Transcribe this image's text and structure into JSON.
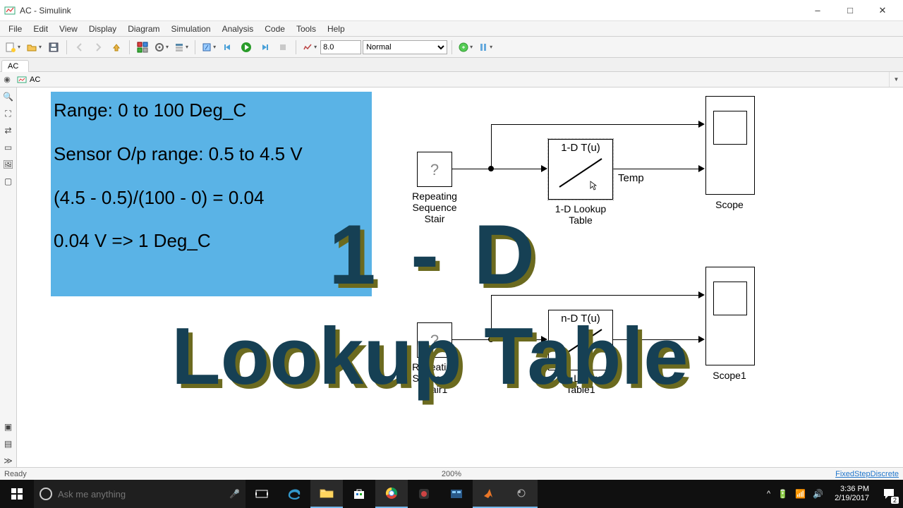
{
  "window": {
    "title": "AC - Simulink"
  },
  "menu": [
    "File",
    "Edit",
    "View",
    "Display",
    "Diagram",
    "Simulation",
    "Analysis",
    "Code",
    "Tools",
    "Help"
  ],
  "toolbar": {
    "stop_time": "8.0",
    "mode": "Normal"
  },
  "tab": {
    "name": "AC"
  },
  "breadcrumb": {
    "model": "AC"
  },
  "annotation": {
    "line1": "Range: 0 to 100 Deg_C",
    "line2": "Sensor O/p range: 0.5 to 4.5 V",
    "line3": "(4.5 - 0.5)/(100 - 0) = 0.04",
    "line4": "0.04 V => 1 Deg_C"
  },
  "blocks": {
    "rss1": {
      "label": "Repeating\nSequence\nStair",
      "glyph": "?"
    },
    "lut1": {
      "header": "1-D T(u)",
      "label": "1-D Lookup\nTable"
    },
    "sig_temp": "Temp",
    "scope1": {
      "label": "Scope"
    },
    "rss2": {
      "label": "Repeating\nSequence\nStair1",
      "glyph": "?"
    },
    "lut2": {
      "header": "n-D T(u)",
      "label": "1-D Lookup\nTable1"
    },
    "scope2": {
      "label": "Scope1"
    }
  },
  "overlay": {
    "top": "1 - D",
    "bottom": "Lookup Table"
  },
  "status": {
    "ready": "Ready",
    "zoom": "200%",
    "solver": "FixedStepDiscrete"
  },
  "taskbar": {
    "search_placeholder": "Ask me anything",
    "time": "3:36 PM",
    "date": "2/19/2017",
    "notif_count": "2"
  }
}
